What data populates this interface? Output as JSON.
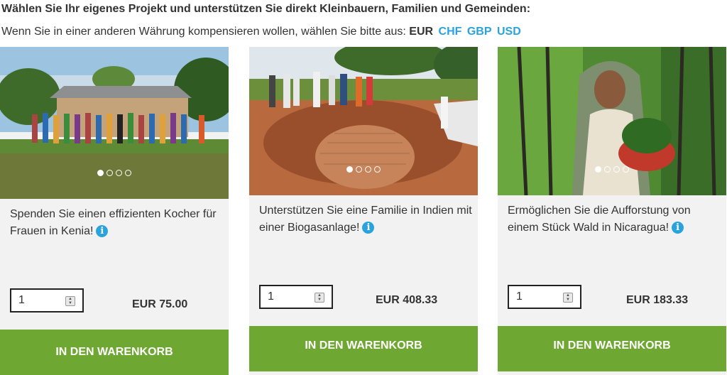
{
  "header": {
    "heading": "Wählen Sie Ihr eigenes Projekt und unterstützen Sie direkt Kleinbauern, Familien und Gemeinden:",
    "currency_prompt": "Wenn Sie in einer anderen Währung kompensieren wollen, wählen Sie bitte aus:",
    "current_currency": "EUR",
    "currency_options": [
      "CHF",
      "GBP",
      "USD"
    ]
  },
  "accent_color": "#2aa3dd",
  "button_color": "#6ea832",
  "projects": [
    {
      "title": "Spenden Sie einen effizienten Kocher für Frauen in Kenia!",
      "quantity": "1",
      "price": "EUR 75.00",
      "cart_label": "IN DEN WARENKORB",
      "carousel_active": 1,
      "carousel_count": 4
    },
    {
      "title": "Unterstützen Sie eine Familie in Indien mit einer Biogasanlage!",
      "quantity": "1",
      "price": "EUR 408.33",
      "cart_label": "IN DEN WARENKORB",
      "carousel_active": 1,
      "carousel_count": 4
    },
    {
      "title": "Ermöglichen Sie die Aufforstung von einem Stück Wald in Nicaragua!",
      "quantity": "1",
      "price": "EUR 183.33",
      "cart_label": "IN DEN WARENKORB",
      "carousel_active": 1,
      "carousel_count": 4
    }
  ]
}
